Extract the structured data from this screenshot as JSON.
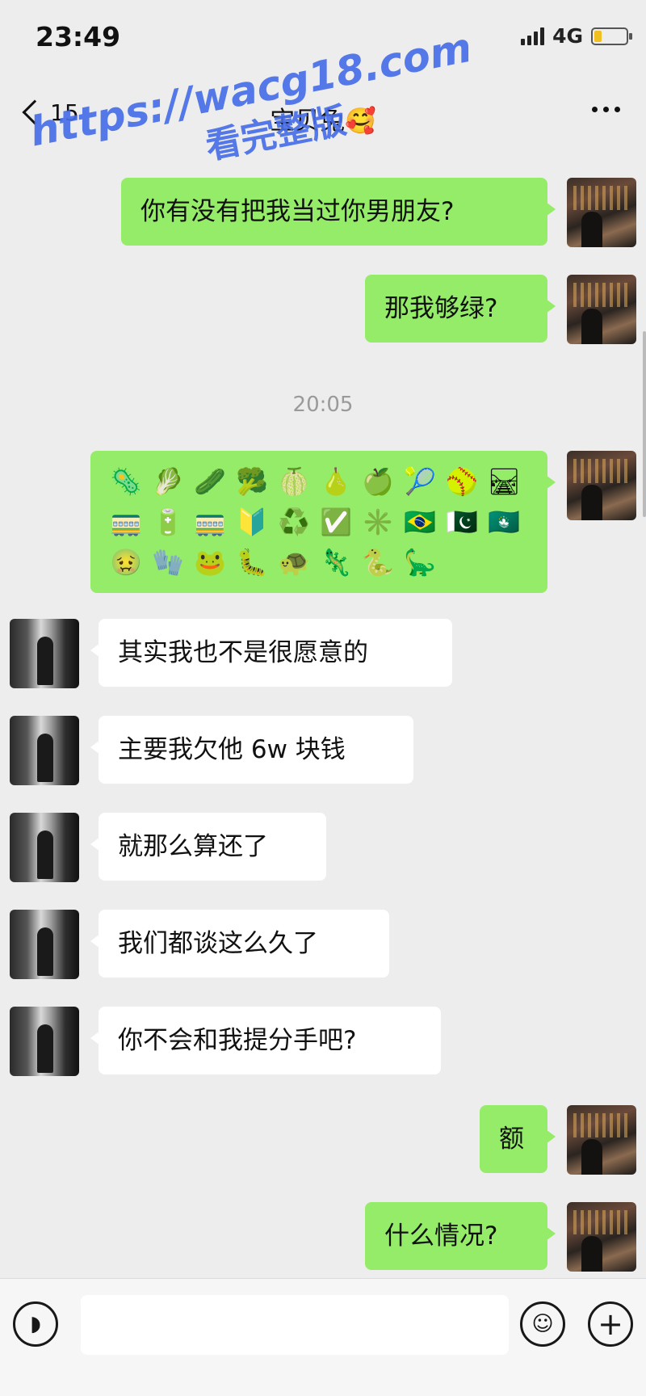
{
  "status_bar": {
    "time": "23:49",
    "network": "4G"
  },
  "nav": {
    "unread_count": "15",
    "title": "宝贝兔🥰"
  },
  "watermark": {
    "line1": "https://wacg18.com",
    "line2": "看完整版"
  },
  "messages": [
    {
      "from": "me",
      "text": "你有没有把我当过你男朋友?"
    },
    {
      "from": "me",
      "text": "那我够绿?"
    },
    {
      "from": "me",
      "type": "emoji",
      "rows": [
        [
          "🦠",
          "🥬",
          "🥒",
          "🥦",
          "🍈",
          "🍐",
          "🍏",
          "🎾",
          "🥎",
          "🛤"
        ],
        [
          "🚃",
          "🔋",
          "🚃",
          "🔰",
          "♻️",
          "✅",
          "✳️",
          "🇧🇷",
          "🇵🇰",
          "🇲🇴"
        ],
        [
          "🤢",
          "🧤",
          "🐸",
          "🐛",
          "🐢",
          "🦎",
          "🐍",
          "🦕"
        ]
      ]
    },
    {
      "from": "her",
      "text": "其实我也不是很愿意的"
    },
    {
      "from": "her",
      "text": "主要我欠他 6w 块钱"
    },
    {
      "from": "her",
      "text": "就那么算还了"
    },
    {
      "from": "her",
      "text": "我们都谈这么久了"
    },
    {
      "from": "her",
      "text": "你不会和我提分手吧?"
    },
    {
      "from": "me",
      "text": "额"
    },
    {
      "from": "me",
      "text": "什么情况?"
    }
  ],
  "timestamp": "20:05"
}
